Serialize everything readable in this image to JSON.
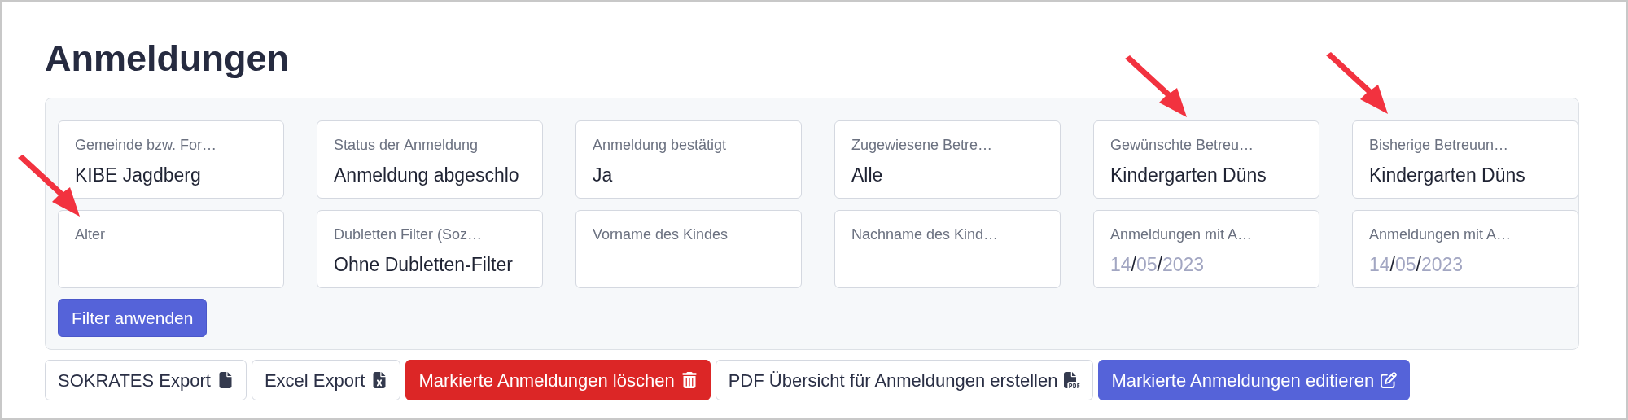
{
  "title": "Anmeldungen",
  "filters": [
    {
      "kind": "text",
      "label": "Gemeinde bzw. For…",
      "value": "KIBE Jagdberg"
    },
    {
      "kind": "text",
      "label": "Status der Anmeldung",
      "value": "Anmeldung abgeschlo"
    },
    {
      "kind": "text",
      "label": "Anmeldung bestätigt",
      "value": "Ja"
    },
    {
      "kind": "text",
      "label": "Zugewiesene Betre…",
      "value": "Alle"
    },
    {
      "kind": "text",
      "label": "Gewünschte Betreu…",
      "value": "Kindergarten Düns"
    },
    {
      "kind": "text",
      "label": "Bisherige Betreuun…",
      "value": "Kindergarten Düns"
    },
    {
      "kind": "text",
      "label": "Alter"
    },
    {
      "kind": "text",
      "label": "Dubletten Filter (Soz…",
      "value": "Ohne Dubletten-Filter"
    },
    {
      "kind": "text",
      "label": "Vorname des Kindes"
    },
    {
      "kind": "text",
      "label": "Nachname des Kind…"
    },
    {
      "kind": "date",
      "label": "Anmeldungen mit A…",
      "date": {
        "day": "14",
        "month": "05",
        "year": "2023",
        "separator": "/"
      }
    },
    {
      "kind": "date",
      "label": "Anmeldungen mit A…",
      "date": {
        "day": "14",
        "month": "05",
        "year": "2023",
        "separator": "/"
      }
    }
  ],
  "apply_button": "Filter anwenden",
  "actions": [
    {
      "kind": "outline",
      "label": "SOKRATES Export"
    },
    {
      "kind": "outline",
      "label": "Excel Export"
    },
    {
      "kind": "danger",
      "label": "Markierte Anmeldungen löschen"
    },
    {
      "kind": "outline",
      "label": "PDF Übersicht für Anmeldungen erstellen"
    },
    {
      "kind": "primary",
      "label": "Markierte Anmeldungen editieren"
    }
  ]
}
